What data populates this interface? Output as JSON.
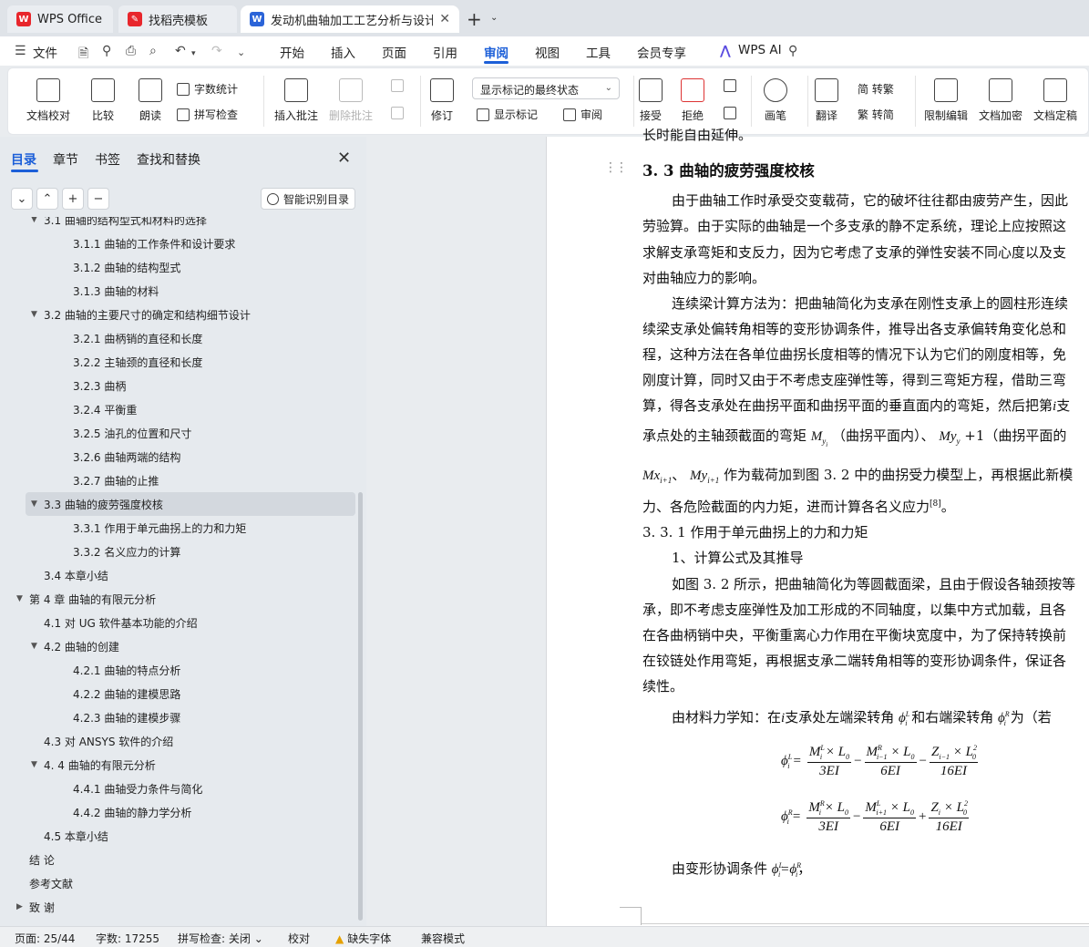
{
  "tabs": {
    "wps": "WPS Office",
    "daoke": "找稻壳模板",
    "doc": "发动机曲轴加工工艺分析与设计"
  },
  "menu": {
    "file": "文件",
    "items": [
      "开始",
      "插入",
      "页面",
      "引用",
      "审阅",
      "视图",
      "工具",
      "会员专享"
    ],
    "active": "审阅",
    "ai": "WPS AI"
  },
  "ribbon": {
    "proofread": "文档校对",
    "compare": "比较",
    "read_aloud": "朗读",
    "word_count": "字数统计",
    "spell_check": "拼写检查",
    "insert_comment": "插入批注",
    "delete_comment": "删除批注",
    "track": "修订",
    "markup_state": "显示标记的最终状态",
    "show_markup": "显示标记",
    "review_pane": "审阅",
    "accept": "接受",
    "reject": "拒绝",
    "pen": "画笔",
    "translate": "翻译",
    "to_traditional": "简 转繁",
    "to_simplified": "繁 转简",
    "restrict_edit": "限制编辑",
    "encrypt": "文档加密",
    "finalize": "文档定稿"
  },
  "nav": {
    "tabs": [
      "目录",
      "章节",
      "书签",
      "查找和替换"
    ],
    "smart_toc": "智能识别目录",
    "items": [
      {
        "text": "3.1  曲轴的结构型式和材料的选择",
        "level": 2,
        "expanded": true
      },
      {
        "text": "3.1.1  曲轴的工作条件和设计要求",
        "level": 3
      },
      {
        "text": "3.1.2  曲轴的结构型式",
        "level": 3
      },
      {
        "text": "3.1.3  曲轴的材料",
        "level": 3
      },
      {
        "text": "3.2  曲轴的主要尺寸的确定和结构细节设计",
        "level": 2,
        "expanded": true
      },
      {
        "text": "3.2.1  曲柄销的直径和长度",
        "level": 3
      },
      {
        "text": "3.2.2  主轴颈的直径和长度",
        "level": 3
      },
      {
        "text": "3.2.3  曲柄",
        "level": 3
      },
      {
        "text": "3.2.4  平衡重",
        "level": 3
      },
      {
        "text": "3.2.5  油孔的位置和尺寸",
        "level": 3
      },
      {
        "text": "3.2.6  曲轴两端的结构",
        "level": 3
      },
      {
        "text": "3.2.7  曲轴的止推",
        "level": 3
      },
      {
        "text": "3.3  曲轴的疲劳强度校核",
        "level": 2,
        "expanded": true,
        "selected": true
      },
      {
        "text": "3.3.1  作用于单元曲拐上的力和力矩",
        "level": 3
      },
      {
        "text": "3.3.2  名义应力的计算",
        "level": 3
      },
      {
        "text": "3.4  本章小结",
        "level": 2
      },
      {
        "text": "第 4 章  曲轴的有限元分析",
        "level": 1,
        "expanded": true
      },
      {
        "text": "4.1  对 UG 软件基本功能的介绍",
        "level": 2
      },
      {
        "text": "4.2  曲轴的创建",
        "level": 2,
        "expanded": true
      },
      {
        "text": "4.2.1  曲轴的特点分析",
        "level": 3
      },
      {
        "text": "4.2.2  曲轴的建模思路",
        "level": 3
      },
      {
        "text": "4.2.3  曲轴的建模步骤",
        "level": 3
      },
      {
        "text": "4.3  对 ANSYS 软件的介绍",
        "level": 2
      },
      {
        "text": "4. 4  曲轴的有限元分析",
        "level": 2,
        "expanded": true
      },
      {
        "text": "4.4.1  曲轴受力条件与简化",
        "level": 3
      },
      {
        "text": "4.4.2  曲轴的静力学分析",
        "level": 3
      },
      {
        "text": "4.5  本章小结",
        "level": 2
      },
      {
        "text": "结      论",
        "level": 1
      },
      {
        "text": "参考文献",
        "level": 1
      },
      {
        "text": "致      谢",
        "level": 1,
        "collapsed": true
      }
    ]
  },
  "doc": {
    "line0": "长时能自由延伸。",
    "heading": "3. 3  曲轴的疲劳强度校核",
    "p1": [
      "由于曲轴工作时承受交变载荷，它的破坏往往都由疲劳产生，因此",
      "劳验算。由于实际的曲轴是一个多支承的静不定系统，理论上应按照这",
      "求解支承弯矩和支反力，因为它考虑了支承的弹性安装不同心度以及支",
      "对曲轴应力的影响。"
    ],
    "p2": [
      "连续梁计算方法为：把曲轴简化为支承在刚性支承上的圆柱形连续",
      "续梁支承处偏转角相等的变形协调条件，推导出各支承偏转角变化总和",
      "程，这种方法在各单位曲拐长度相等的情况下认为它们的刚度相等，免",
      "刚度计算，同时又由于不考虑支座弹性等，得到三弯矩方程，借助三弯",
      "算，得各支承处在曲拐平面和曲拐平面的垂直面内的弯矩，然后把第"
    ],
    "p2_tail_i": "i",
    "p2_tail": "支",
    "p2_line6a": "承点处的主轴颈截面的弯矩",
    "p2_line6b": "（曲拐平面内）、",
    "p2_line6c": "+1（曲拐平面的",
    "p2_line7a": "作为载荷加到图 3. 2 中的曲拐受力模型上，再根据此新模",
    "p2_line8": "力、各危险截面的内力矩，进而计算各名义应力",
    "cite": "[8]",
    "p2_line8_end": "。",
    "sub1": "3. 3. 1  作用于单元曲拐上的力和力矩",
    "sub2": "1、计算公式及其推导",
    "p3": [
      "如图 3. 2 所示，把曲轴简化为等圆截面梁，且由于假设各轴颈按等",
      "承，即不考虑支座弹性及加工形成的不同轴度，以集中方式加载，且各",
      "在各曲柄销中央，平衡重离心力作用在平衡块宽度中，为了保持转换前",
      "在铰链处作用弯矩，再根据支承二端转角相等的变形协调条件，保证各",
      "续性。"
    ],
    "p4a": "由材料力学知：在",
    "p4b": "支承处左端梁转角",
    "p4c": "和右端梁转角",
    "p4d": "为（若",
    "p5": "由变形协调条件",
    "p5_end": "，"
  },
  "status": {
    "page": "页面: 25/44",
    "words": "字数: 17255",
    "spell": "拼写检查: 关闭",
    "proof": "校对",
    "missing_font": "缺失字体",
    "compat": "兼容模式"
  },
  "colors": {
    "accent": "#1c5fd8",
    "wps_red": "#e8262c",
    "warn": "#e5a100"
  }
}
